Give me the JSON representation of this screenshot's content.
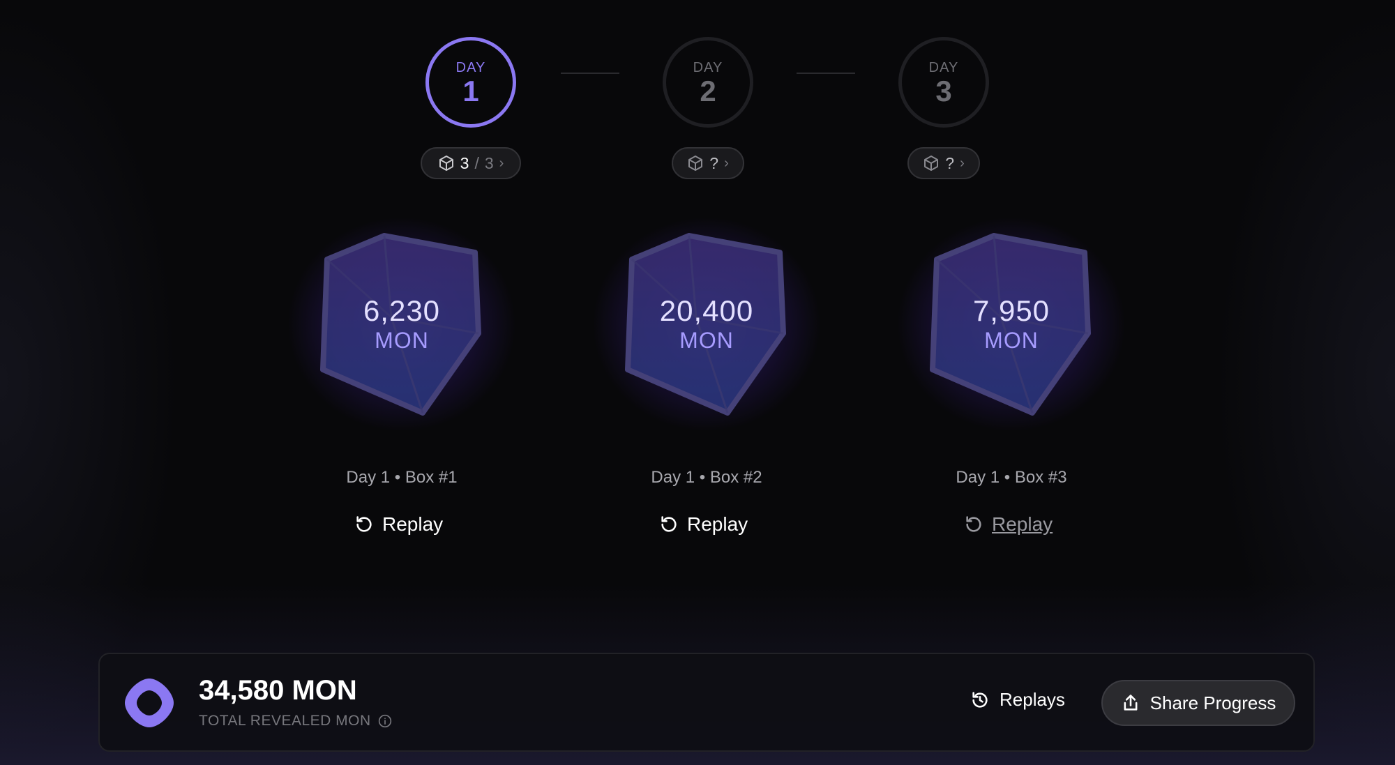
{
  "stepper": {
    "steps": [
      {
        "label": "DAY",
        "number": "1",
        "state": "active"
      },
      {
        "label": "DAY",
        "number": "2",
        "state": "locked"
      },
      {
        "label": "DAY",
        "number": "3",
        "state": "locked"
      }
    ],
    "pills": [
      {
        "done": "3",
        "separator": "/",
        "total": "3",
        "icon": "box-icon"
      },
      {
        "value": "?",
        "icon": "box-icon"
      },
      {
        "value": "?",
        "icon": "box-icon"
      }
    ]
  },
  "boxes": [
    {
      "value": "6,230",
      "unit": "MON",
      "caption": "Day 1 • Box #1",
      "replay_label": "Replay"
    },
    {
      "value": "20,400",
      "unit": "MON",
      "caption": "Day 1 • Box #2",
      "replay_label": "Replay"
    },
    {
      "value": "7,950",
      "unit": "MON",
      "caption": "Day 1 • Box #3",
      "replay_label": "Replay"
    }
  ],
  "footer": {
    "total_value": "34,580 MON",
    "total_label": "TOTAL REVEALED MON",
    "replays_label": "Replays",
    "share_label": "Share Progress"
  },
  "colors": {
    "accent": "#8b78f2",
    "background": "#08080a",
    "muted": "#6d6d73"
  }
}
